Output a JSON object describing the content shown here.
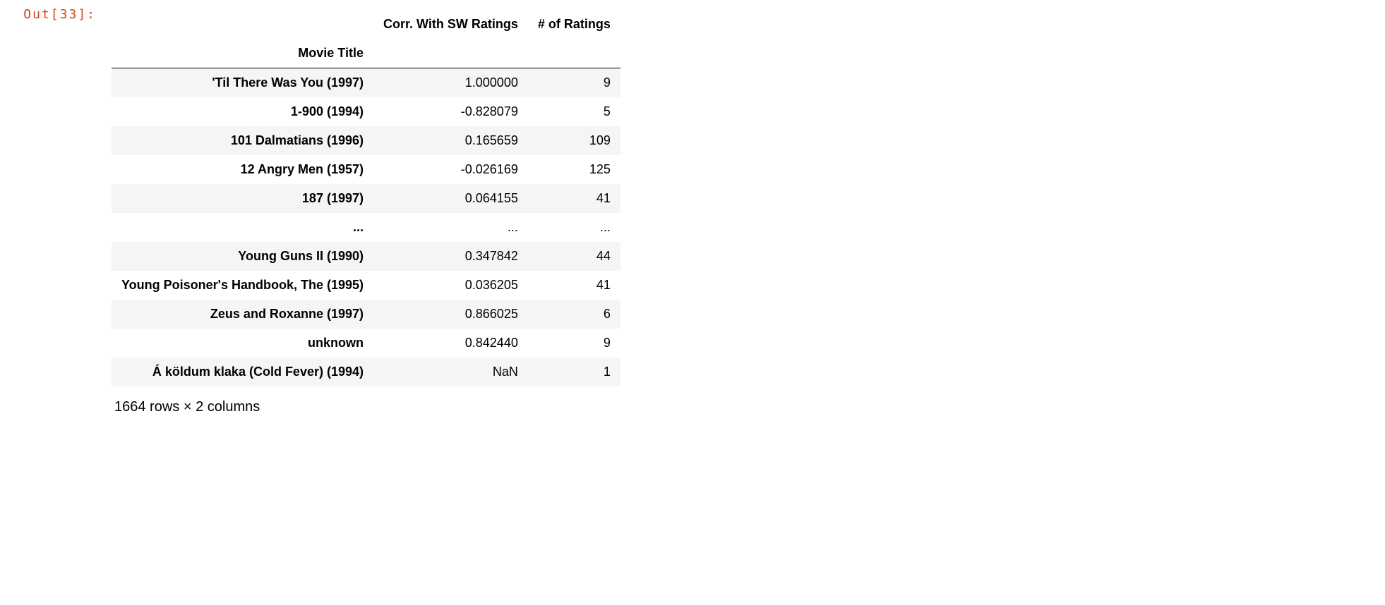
{
  "prompt": "Out[33]:",
  "table": {
    "index_name": "Movie Title",
    "columns": [
      "Corr. With SW Ratings",
      "# of Ratings"
    ],
    "rows": [
      {
        "index": "'Til There Was You (1997)",
        "cells": [
          "1.000000",
          "9"
        ]
      },
      {
        "index": "1-900 (1994)",
        "cells": [
          "-0.828079",
          "5"
        ]
      },
      {
        "index": "101 Dalmatians (1996)",
        "cells": [
          "0.165659",
          "109"
        ]
      },
      {
        "index": "12 Angry Men (1957)",
        "cells": [
          "-0.026169",
          "125"
        ]
      },
      {
        "index": "187 (1997)",
        "cells": [
          "0.064155",
          "41"
        ]
      },
      {
        "index": "...",
        "cells": [
          "...",
          "..."
        ]
      },
      {
        "index": "Young Guns II (1990)",
        "cells": [
          "0.347842",
          "44"
        ]
      },
      {
        "index": "Young Poisoner's Handbook, The (1995)",
        "cells": [
          "0.036205",
          "41"
        ]
      },
      {
        "index": "Zeus and Roxanne (1997)",
        "cells": [
          "0.866025",
          "6"
        ]
      },
      {
        "index": "unknown",
        "cells": [
          "0.842440",
          "9"
        ]
      },
      {
        "index": "Á köldum klaka (Cold Fever) (1994)",
        "cells": [
          "NaN",
          "1"
        ]
      }
    ]
  },
  "shape_info": "1664 rows × 2 columns"
}
